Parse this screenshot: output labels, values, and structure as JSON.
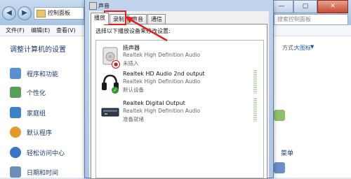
{
  "cp": {
    "address": "控制面板",
    "search_placeholder": "搜索控制面板",
    "window_buttons": {
      "minimize": "—",
      "maximize": "▢",
      "close": "✕"
    },
    "menu": [
      "文件(F)",
      "编辑(E)",
      "查看(V)"
    ],
    "heading": "调整计算机的设置",
    "view_by_label": "方式:",
    "view_by_value": "大图标",
    "categories": [
      {
        "label": "程序和功能",
        "color": "#5b8fd3"
      },
      {
        "label": "个性化",
        "color": "#56a05a"
      },
      {
        "label": "家庭组",
        "color": "#3a83c9"
      },
      {
        "label": "默认程序",
        "color": "#e39a2a"
      },
      {
        "label": "轻松访问中心",
        "color": "#3b74c4"
      },
      {
        "label": "日期和时间",
        "color": "#6b8fb8"
      }
    ],
    "right_label": "菜单"
  },
  "dialog": {
    "title": "声音",
    "tabs": [
      "播放",
      "录制",
      "声音",
      "通信"
    ],
    "instruction": "选择以下播放设备来修改设置:",
    "devices": [
      {
        "name": "扬声器",
        "desc": "Realtek High Definition Audio",
        "status": "未插入",
        "icon": "speaker-icon",
        "badge": "unplugged"
      },
      {
        "name": "Realtek HD Audio 2nd output",
        "desc": "Realtek High Definition Audio",
        "status": "默认设备",
        "icon": "headphones-icon",
        "badge": "default-check"
      },
      {
        "name": "Realtek Digital Output",
        "desc": "Realtek High Definition Audio",
        "status": "准备就绪",
        "icon": "digital-output-icon",
        "badge": "none"
      }
    ]
  },
  "annotation": {
    "highlight_color": "#e02020",
    "target": "录制"
  }
}
